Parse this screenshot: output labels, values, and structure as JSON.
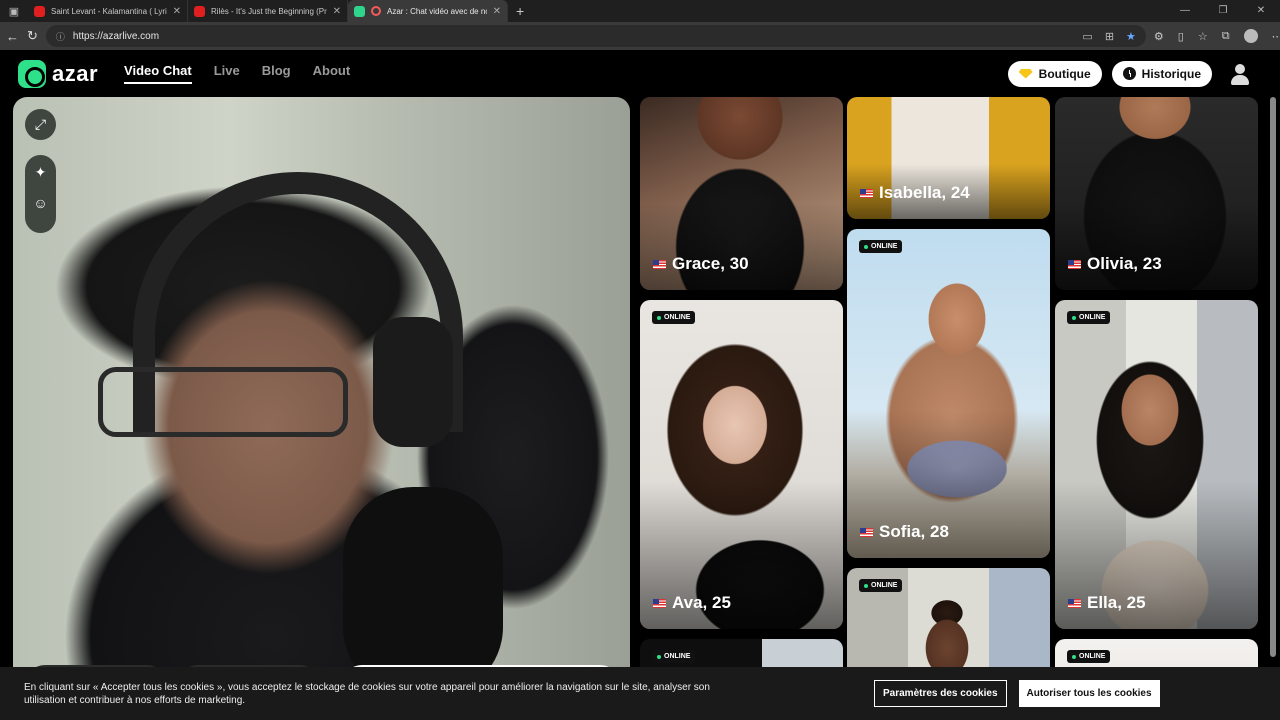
{
  "browser": {
    "tabs": [
      {
        "title": "Saint Levant - Kalamantina ( Lyric",
        "favicon": "youtube-icon",
        "active": false
      },
      {
        "title": "Rilès - It's Just the Beginning (Pro",
        "favicon": "youtube-icon",
        "active": false
      },
      {
        "title": "Azar : Chat vidéo avec de no",
        "favicon": "azar-icon",
        "active": true
      }
    ],
    "url": "https://azarlive.com"
  },
  "header": {
    "logo": "azar",
    "nav": [
      {
        "label": "Video Chat",
        "active": true
      },
      {
        "label": "Live",
        "active": false
      },
      {
        "label": "Blog",
        "active": false
      },
      {
        "label": "About",
        "active": false
      }
    ],
    "boutique_label": "Boutique",
    "historique_label": "Historique"
  },
  "profiles": [
    {
      "name": "Grace, 30",
      "online": false,
      "country": "US"
    },
    {
      "name": "Isabella, 24",
      "online": false,
      "country": "US"
    },
    {
      "name": "Olivia, 23",
      "online": false,
      "country": "US"
    },
    {
      "name": "Ava, 25",
      "online": true,
      "country": "US"
    },
    {
      "name": "Sofia, 28",
      "online": true,
      "country": "US"
    },
    {
      "name": "Ella, 25",
      "online": true,
      "country": "US"
    },
    {
      "name": "",
      "online": true,
      "country": ""
    },
    {
      "name": "",
      "online": true,
      "country": ""
    },
    {
      "name": "",
      "online": true,
      "country": ""
    }
  ],
  "badge_online": "ONLINE",
  "cookie": {
    "text": "En cliquant sur « Accepter tous les cookies », vous acceptez le stockage de cookies sur votre appareil pour améliorer la navigation sur le site, analyser son utilisation et contribuer à nos efforts de marketing.",
    "settings_label": "Paramètres des cookies",
    "accept_label": "Autoriser tous les cookies"
  },
  "colors": {
    "brand": "#2fe08a",
    "online": "#2fe08a"
  }
}
